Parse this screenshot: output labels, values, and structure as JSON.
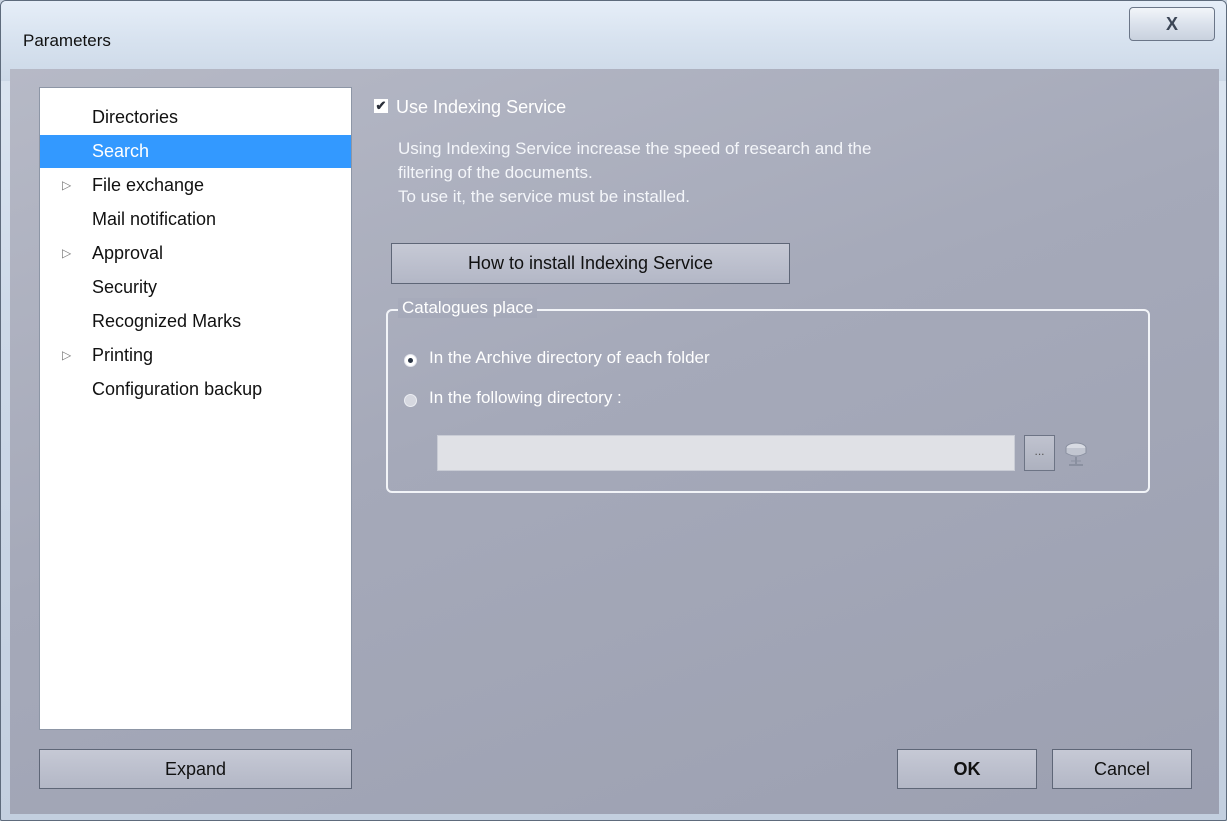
{
  "window": {
    "title": "Parameters",
    "close_glyph": "X"
  },
  "tree": {
    "items": [
      {
        "label": "Directories",
        "has_children": false,
        "selected": false
      },
      {
        "label": "Search",
        "has_children": false,
        "selected": true
      },
      {
        "label": "File exchange",
        "has_children": true,
        "selected": false
      },
      {
        "label": "Mail notification",
        "has_children": false,
        "selected": false
      },
      {
        "label": "Approval",
        "has_children": true,
        "selected": false
      },
      {
        "label": "Security",
        "has_children": false,
        "selected": false
      },
      {
        "label": "Recognized Marks",
        "has_children": false,
        "selected": false
      },
      {
        "label": "Printing",
        "has_children": true,
        "selected": false
      },
      {
        "label": "Configuration backup",
        "has_children": false,
        "selected": false
      }
    ],
    "expand_arrow_glyph": "▷"
  },
  "search": {
    "use_indexing_label": "Use Indexing Service",
    "use_indexing_checked": true,
    "check_glyph": "✔",
    "description": [
      "Using Indexing Service increase the speed of research and the",
      "filtering of the documents.",
      "To use it, the service must be installed."
    ],
    "how_to_install_label": "How to install Indexing Service",
    "catalogues": {
      "legend": "Catalogues place",
      "option_archive": "In the Archive directory of each folder",
      "option_following": "In the following directory :",
      "selected_option": "archive",
      "directory_value": "",
      "browse_label": "..."
    }
  },
  "buttons": {
    "expand": "Expand",
    "ok": "OK",
    "cancel": "Cancel"
  },
  "colors": {
    "selection": "#3399ff",
    "panel_bg": "#a5a9b9"
  },
  "icons": {
    "network_folder": "network-drive-icon"
  }
}
